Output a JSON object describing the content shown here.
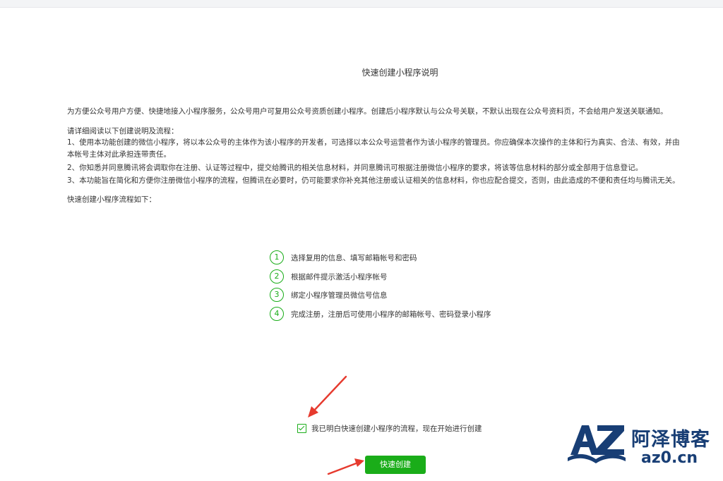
{
  "page": {
    "title": "快速创建小程序说明",
    "intro": "为方便公众号用户方便、快捷地接入小程序服务，公众号用户可复用公众号资质创建小程序。创建后小程序默认与公众号关联，不默认出现在公众号资料页，不会给用户发送关联通知。",
    "read_notice": "请详细阅读以下创建说明及流程：",
    "clauses": [
      "1、使用本功能创建的微信小程序，将以本公众号的主体作为该小程序的开发者，可选择以本公众号运营者作为该小程序的管理员。你应确保本次操作的主体和行为真实、合法、有效，并由",
      "本帐号主体对此承担连带责任。",
      "2、你知悉并同意腾讯将会调取你在注册、认证等过程中，提交给腾讯的相关信息材料，并同意腾讯可根据注册微信小程序的要求，将该等信息材料的部分或全部用于信息登记。",
      "3、本功能旨在简化和方便你注册微信小程序的流程，但腾讯在必要时，仍可能要求你补充其他注册或认证相关的信息材料，你也应配合提交，否则，由此造成的不便和责任均与腾讯无关。"
    ],
    "flow_heading": "快速创建小程序流程如下："
  },
  "steps": [
    {
      "num": "1",
      "label": "选择复用的信息、填写邮箱帐号和密码"
    },
    {
      "num": "2",
      "label": "根据邮件提示激活小程序帐号"
    },
    {
      "num": "3",
      "label": "绑定小程序管理员微信号信息"
    },
    {
      "num": "4",
      "label": "完成注册，注册后可使用小程序的邮箱帐号、密码登录小程序"
    }
  ],
  "agreement": {
    "checked": true,
    "label": "我已明白快速创建小程序的流程，现在开始进行创建"
  },
  "create_button": {
    "label": "快速创建"
  },
  "watermark": {
    "logo_text": "AZ",
    "name": "阿泽博客",
    "url": "az0.cn"
  },
  "colors": {
    "accent_green": "#1aad19",
    "annotation_red": "#e63a2e",
    "brand_navy": "#183e75"
  },
  "icons": {
    "step_marker": "circled-number",
    "checkbox": "checkmark-icon",
    "annotation": "red-arrow-icon"
  }
}
